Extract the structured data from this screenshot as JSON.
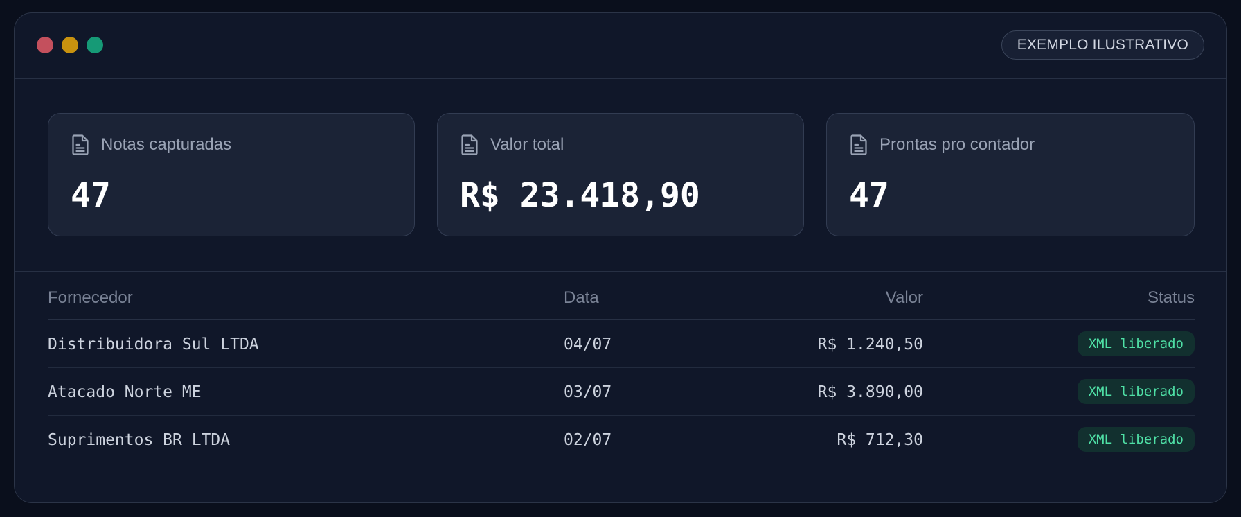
{
  "window": {
    "controls": [
      "close",
      "minimize",
      "zoom"
    ],
    "control_colors": {
      "close": "#c4505d",
      "minimize": "#c8920f",
      "zoom": "#169a76"
    },
    "tag_label": "EXEMPLO ILUSTRATIVO"
  },
  "stats": [
    {
      "icon": "document-icon",
      "label": "Notas capturadas",
      "value": "47"
    },
    {
      "icon": "document-icon",
      "label": "Valor total",
      "value": "R$ 23.418,90"
    },
    {
      "icon": "document-icon",
      "label": "Prontas pro contador",
      "value": "47"
    }
  ],
  "table": {
    "headers": {
      "supplier": "Fornecedor",
      "date": "Data",
      "value": "Valor",
      "status": "Status"
    },
    "rows": [
      {
        "supplier": "Distribuidora Sul LTDA",
        "date": "04/07",
        "value": "R$ 1.240,50",
        "status": "XML liberado"
      },
      {
        "supplier": "Atacado Norte ME",
        "date": "03/07",
        "value": "R$ 3.890,00",
        "status": "XML liberado"
      },
      {
        "supplier": "Suprimentos BR LTDA",
        "date": "02/07",
        "value": "R$ 712,30",
        "status": "XML liberado"
      }
    ]
  },
  "colors": {
    "background": "#101729",
    "card": "#1b2336",
    "status_badge_bg": "#12302f",
    "status_badge_text": "#4fe0a6"
  }
}
